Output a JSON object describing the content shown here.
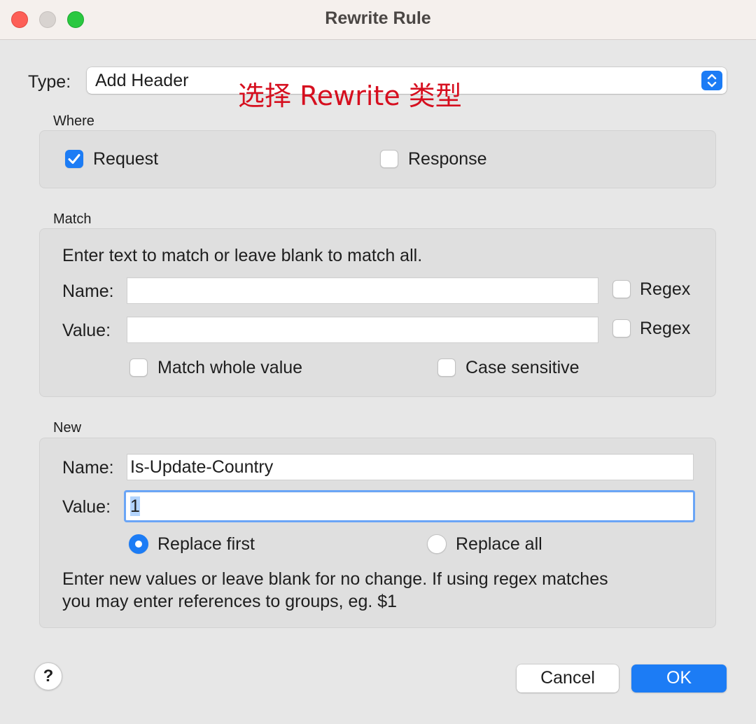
{
  "window": {
    "title": "Rewrite Rule"
  },
  "type_row": {
    "label": "Type:",
    "selected": "Add Header",
    "annotation": "选择 Rewrite 类型"
  },
  "where": {
    "heading": "Where",
    "request": {
      "label": "Request",
      "checked": true
    },
    "response": {
      "label": "Response",
      "checked": false
    }
  },
  "match": {
    "heading": "Match",
    "hint": "Enter text to match or leave blank to match all.",
    "name_label": "Name:",
    "name_value": "",
    "value_label": "Value:",
    "value_value": "",
    "regex_label": "Regex",
    "name_regex_checked": false,
    "value_regex_checked": false,
    "match_whole_value": {
      "label": "Match whole value",
      "checked": false
    },
    "case_sensitive": {
      "label": "Case sensitive",
      "checked": false
    }
  },
  "new": {
    "heading": "New",
    "name_label": "Name:",
    "name_value": "Is-Update-Country",
    "value_label": "Value:",
    "value_value": "1",
    "replace_first": {
      "label": "Replace first",
      "selected": true
    },
    "replace_all": {
      "label": "Replace all",
      "selected": false
    },
    "hint_line1": "Enter new values or leave blank for no change. If using regex matches",
    "hint_line2": "you may enter references to groups, eg. $1"
  },
  "buttons": {
    "help": "?",
    "cancel": "Cancel",
    "ok": "OK"
  },
  "colors": {
    "accent": "#1c7cf5",
    "annotation": "#d60f1f",
    "window_bg": "#e7e7e7",
    "group_bg": "#dfdfdf"
  },
  "icons": [
    "checkmark-icon",
    "chevron-up-down-icon",
    "question-mark-icon"
  ]
}
